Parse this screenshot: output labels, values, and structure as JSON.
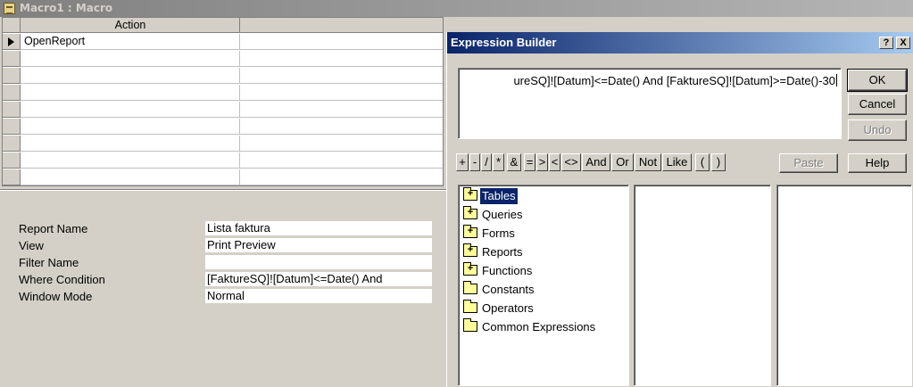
{
  "macro_window": {
    "title": "Macro1 : Macro",
    "grid": {
      "headers": [
        "Action",
        ""
      ],
      "rows": [
        {
          "action": "OpenReport",
          "comment": "",
          "current": true
        },
        {
          "action": "",
          "comment": ""
        },
        {
          "action": "",
          "comment": ""
        },
        {
          "action": "",
          "comment": ""
        },
        {
          "action": "",
          "comment": ""
        },
        {
          "action": "",
          "comment": ""
        },
        {
          "action": "",
          "comment": ""
        },
        {
          "action": "",
          "comment": ""
        },
        {
          "action": "",
          "comment": ""
        }
      ]
    },
    "properties": [
      {
        "label": "Report Name",
        "value": "Lista faktura"
      },
      {
        "label": "View",
        "value": "Print Preview"
      },
      {
        "label": "Filter Name",
        "value": ""
      },
      {
        "label": "Where Condition",
        "value": "[FaktureSQ]![Datum]<=Date() And"
      },
      {
        "label": "Window Mode",
        "value": "Normal"
      }
    ]
  },
  "expression_builder": {
    "title": "Expression Builder",
    "title_buttons": {
      "help": "?",
      "close": "X"
    },
    "expression": "ureSQ]![Datum]<=Date() And [FaktureSQ]![Datum]>=Date()-30",
    "buttons": {
      "ok": "OK",
      "cancel": "Cancel",
      "undo": "Undo",
      "help": "Help",
      "paste": "Paste"
    },
    "operators": [
      "+",
      "-",
      "/",
      "*",
      "&",
      "=",
      ">",
      "<",
      "<>",
      "And",
      "Or",
      "Not",
      "Like",
      "(",
      ")"
    ],
    "tree": [
      {
        "label": "Tables",
        "icon": "folder-plus-icon",
        "expandable": true,
        "selected": true
      },
      {
        "label": "Queries",
        "icon": "folder-plus-icon",
        "expandable": true
      },
      {
        "label": "Forms",
        "icon": "folder-plus-icon",
        "expandable": true
      },
      {
        "label": "Reports",
        "icon": "folder-plus-icon",
        "expandable": true
      },
      {
        "label": "Functions",
        "icon": "folder-plus-icon",
        "expandable": true
      },
      {
        "label": "Constants",
        "icon": "folder-icon",
        "expandable": false
      },
      {
        "label": "Operators",
        "icon": "folder-icon",
        "expandable": false
      },
      {
        "label": "Common Expressions",
        "icon": "folder-icon",
        "expandable": false
      }
    ]
  },
  "colors": {
    "active_title": "#0a246a",
    "inactive_title": "#808080",
    "face": "#d4d0c8",
    "selection": "#0a246a"
  }
}
